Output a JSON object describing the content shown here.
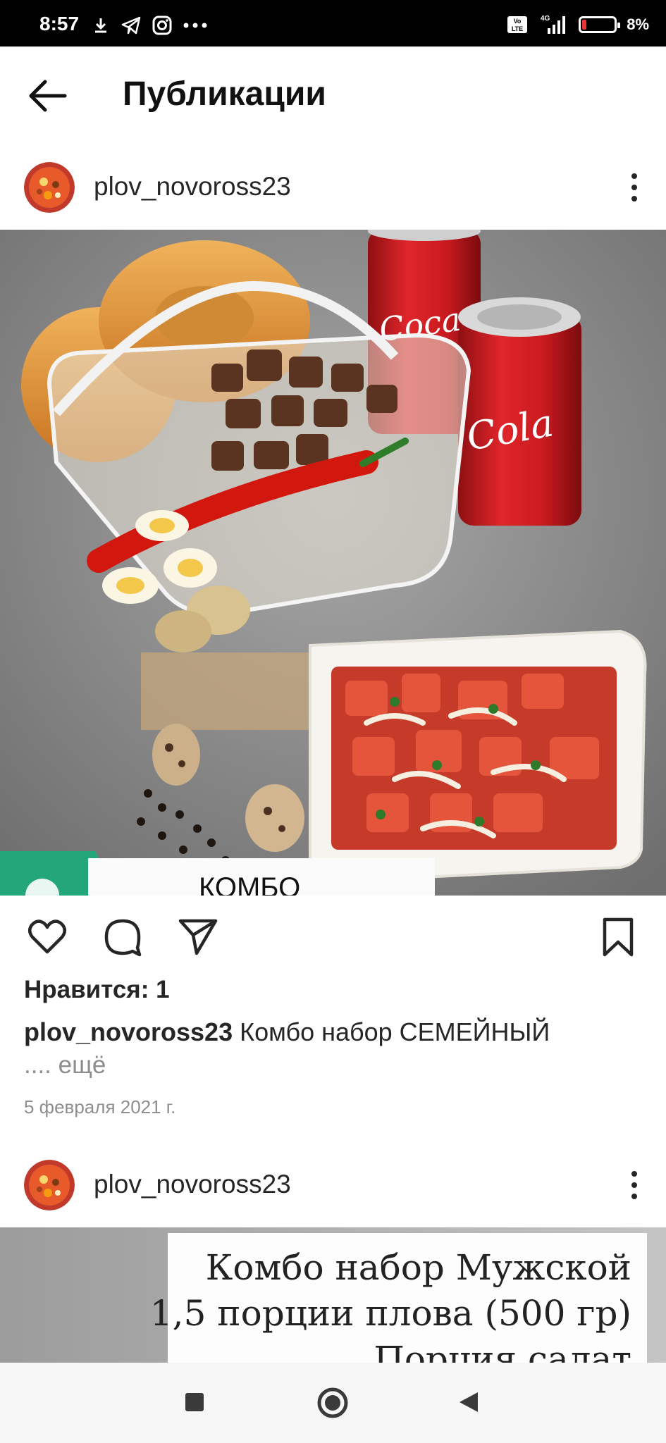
{
  "status_bar": {
    "time": "8:57",
    "battery": "8%",
    "network": "4G",
    "lte_badge": "Vo LTE"
  },
  "header": {
    "title": "Публикации"
  },
  "post1": {
    "username": "plov_novoross23",
    "image_label": "КОМБО",
    "likes": "Нравится: 1",
    "caption_user": "plov_novoross23",
    "caption_text": " Комбо набор СЕМЕЙНЫЙ",
    "more": ".... ещё",
    "date": "5 февраля 2021 г."
  },
  "post2": {
    "username": "plov_novoross23",
    "image_lines": [
      "Комбо набор Мужской",
      "1,5 порции плова (500 гр)",
      "Порция салат"
    ]
  },
  "icons": {
    "back": "arrow-left-icon",
    "more": "more-vertical-icon",
    "like": "heart-icon",
    "comment": "comment-icon",
    "share": "send-icon",
    "save": "bookmark-icon",
    "nav_recent": "square-icon",
    "nav_home": "circle-icon",
    "nav_back": "triangle-back-icon"
  },
  "colors": {
    "status_bar_bg": "#000000",
    "text_primary": "#262626",
    "text_secondary": "#8e8e8e",
    "coke_red": "#d41e25",
    "badge_green": "#22a67a"
  }
}
